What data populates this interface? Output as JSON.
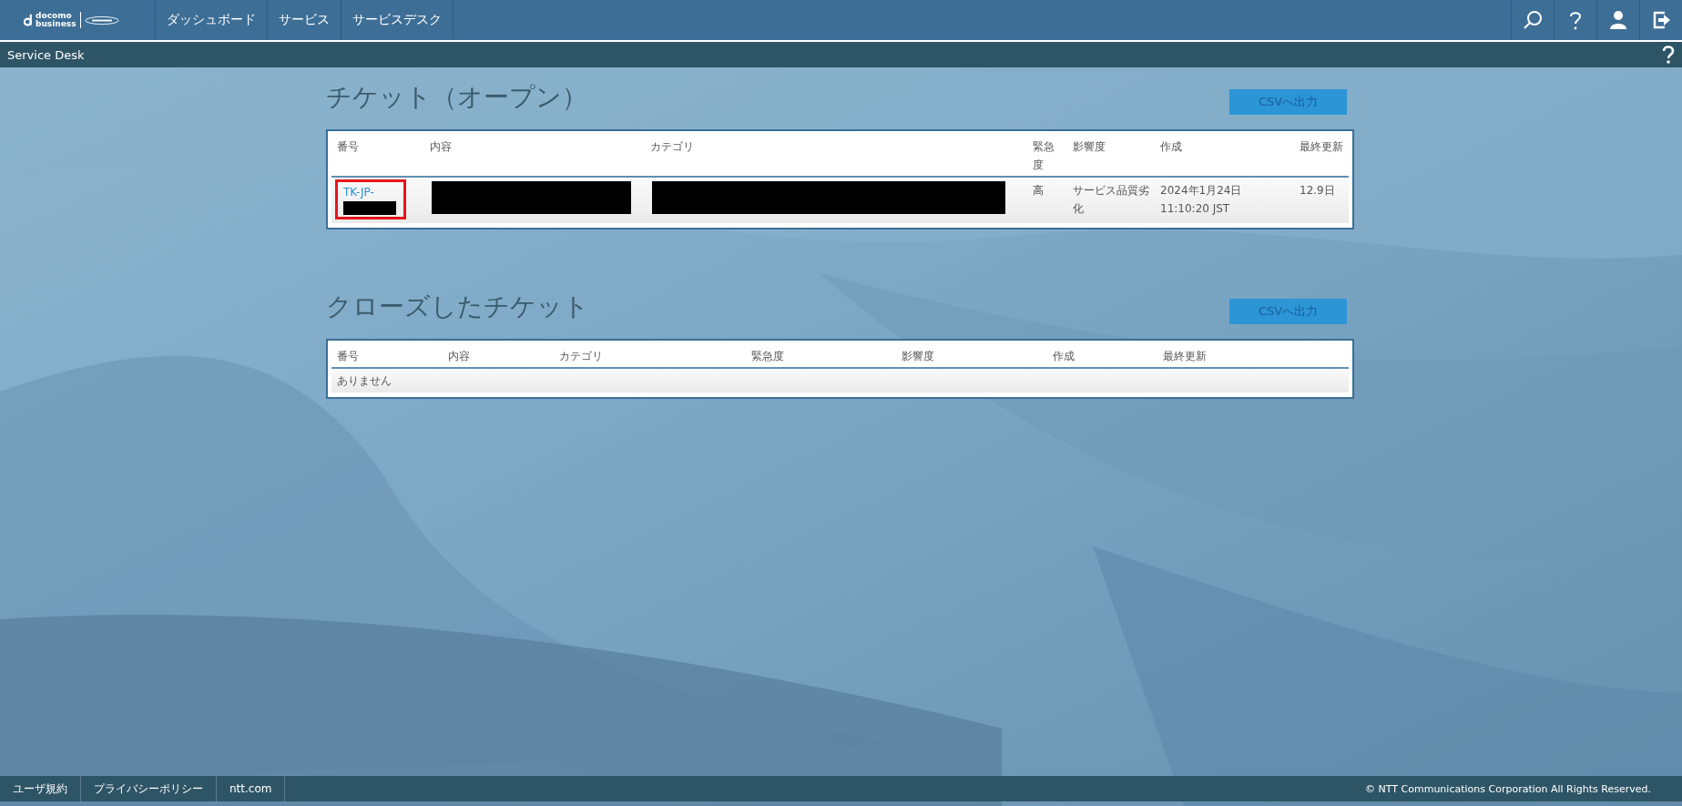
{
  "header": {
    "logo": {
      "lines": [
        "docomo",
        "business"
      ]
    },
    "nav": [
      {
        "label": "ダッシュボード"
      },
      {
        "label": "サービス"
      },
      {
        "label": "サービスデスク"
      }
    ],
    "icons": [
      {
        "kind": "search"
      },
      {
        "kind": "help"
      },
      {
        "kind": "user"
      },
      {
        "kind": "logout"
      }
    ]
  },
  "subbar": {
    "title": "Service Desk"
  },
  "open_tickets": {
    "title": "チケット（オープン）",
    "export_button": "CSVへ出力",
    "columns": [
      "番号",
      "内容",
      "カテゴリ",
      "緊急度",
      "影響度",
      "作成",
      "最終更新"
    ],
    "rows": [
      {
        "cells": [
          {
            "kind": "link",
            "text": "TK-JP-",
            "redacted": true,
            "highlighted": true
          },
          {
            "kind": "redacted"
          },
          {
            "kind": "redacted"
          },
          {
            "kind": "text",
            "text": "高"
          },
          {
            "kind": "text",
            "text": "サービス品質劣化"
          },
          {
            "kind": "text",
            "text": "2024年1月24日 11:10:20 JST"
          },
          {
            "kind": "text",
            "text": "12.9日"
          }
        ]
      }
    ]
  },
  "closed_tickets": {
    "title": "クローズしたチケット",
    "export_button": "CSVへ出力",
    "columns": [
      "番号",
      "内容",
      "カテゴリ",
      "緊急度",
      "影響度",
      "作成",
      "最終更新"
    ],
    "empty_message": "ありません"
  },
  "footer": {
    "links": [
      "ユーザ規約",
      "プライバシーポリシー",
      "ntt.com"
    ],
    "copyright": "© NTT Communications Corporation All Rights Reserved."
  }
}
